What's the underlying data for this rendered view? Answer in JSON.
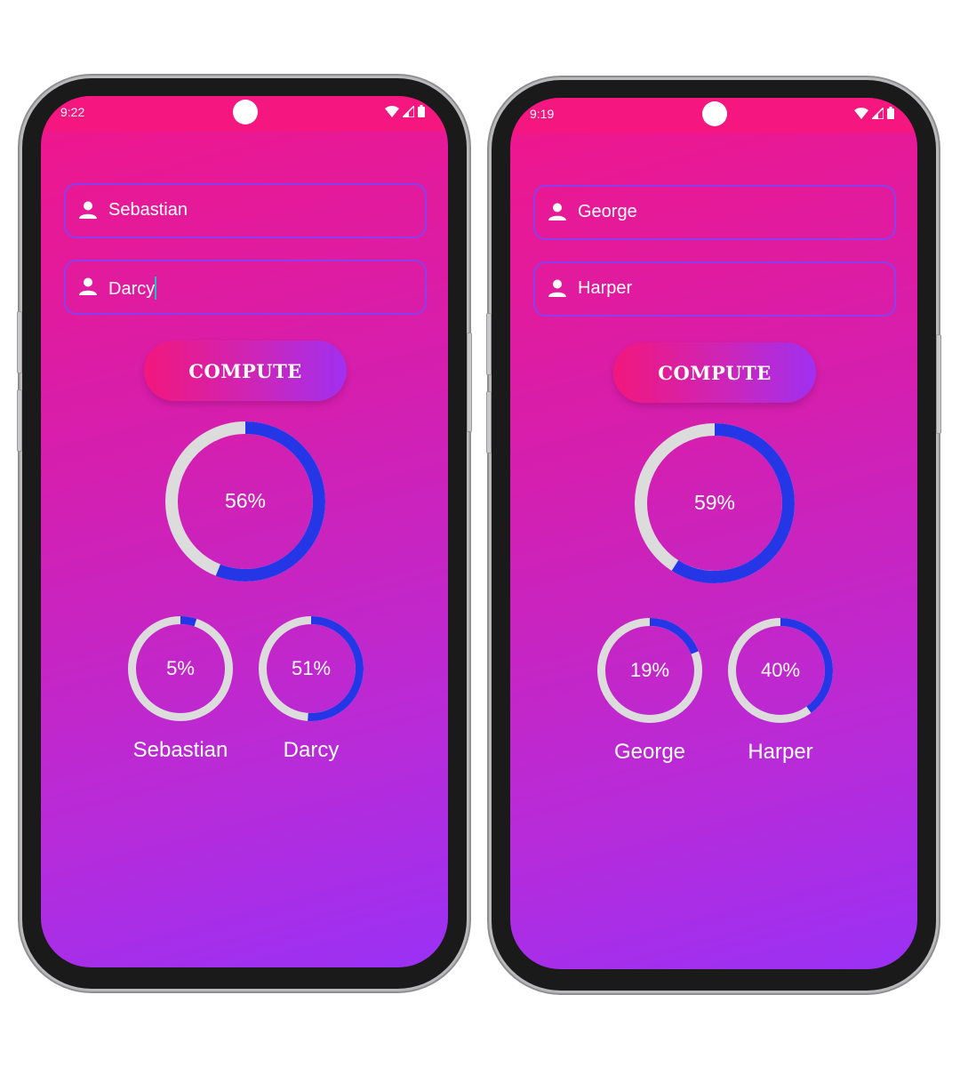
{
  "colors": {
    "ring_fill": "#2536e6",
    "ring_track": "#dcdcdc",
    "field_border": "#8a3ef0",
    "gradient_top": "#f0168a",
    "gradient_bottom": "#9a31f5"
  },
  "phones": [
    {
      "time": "9:22",
      "status_icons": [
        "wifi-icon",
        "signal-icon",
        "battery-icon"
      ],
      "field1": {
        "icon": "person-icon",
        "value": "Sebastian"
      },
      "field2": {
        "icon": "person-icon",
        "value": "Darcy",
        "focused": true
      },
      "compute_label": "COMPUTE",
      "match": {
        "label": "56%",
        "value": 56
      },
      "person1": {
        "label": "5%",
        "value": 5,
        "name": "Sebastian"
      },
      "person2": {
        "label": "51%",
        "value": 51,
        "name": "Darcy"
      }
    },
    {
      "time": "9:19",
      "status_icons": [
        "wifi-icon",
        "signal-icon",
        "battery-icon"
      ],
      "field1": {
        "icon": "person-icon",
        "value": "George"
      },
      "field2": {
        "icon": "person-icon",
        "value": "Harper",
        "focused": false
      },
      "compute_label": "COMPUTE",
      "match": {
        "label": "59%",
        "value": 59
      },
      "person1": {
        "label": "19%",
        "value": 19,
        "name": "George"
      },
      "person2": {
        "label": "40%",
        "value": 40,
        "name": "Harper"
      }
    }
  ]
}
